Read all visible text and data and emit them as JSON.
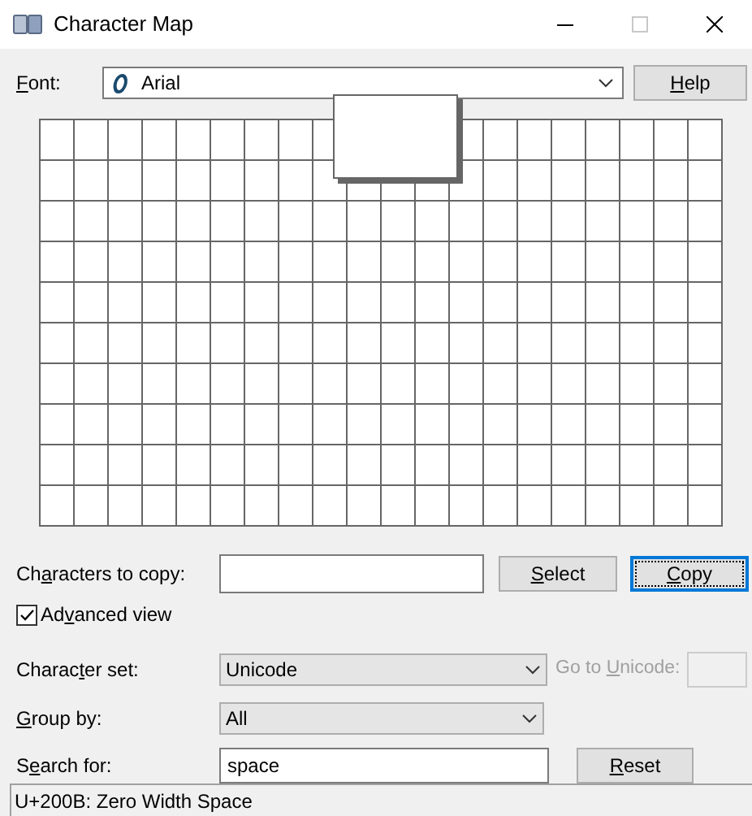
{
  "window": {
    "title": "Character Map",
    "maximize_disabled": true
  },
  "font": {
    "label": [
      {
        "text": "F",
        "underline": true
      },
      {
        "text": "ont:",
        "underline": false
      }
    ],
    "value": "Arial"
  },
  "help_button": {
    "label": [
      {
        "text": "H",
        "underline": true
      },
      {
        "text": "elp",
        "underline": false
      }
    ]
  },
  "copy_row": {
    "label": [
      {
        "text": "Ch",
        "underline": false
      },
      {
        "text": "a",
        "underline": true
      },
      {
        "text": "racters to copy:",
        "underline": false
      }
    ]
  },
  "buttons": [
    {
      "label": [
        {
          "text": "S",
          "underline": true
        },
        {
          "text": "elect",
          "underline": false
        }
      ],
      "focused": false
    },
    {
      "label": [
        {
          "text": "C",
          "underline": true
        },
        {
          "text": "opy",
          "underline": false
        }
      ],
      "focused": true
    }
  ],
  "advanced_view": {
    "label": [
      {
        "text": "Ad",
        "underline": false
      },
      {
        "text": "v",
        "underline": true
      },
      {
        "text": "anced view",
        "underline": false
      }
    ],
    "checked": true
  },
  "character_set": {
    "label": [
      {
        "text": "Charac",
        "underline": false
      },
      {
        "text": "t",
        "underline": true
      },
      {
        "text": "er set:",
        "underline": false
      }
    ],
    "value": "Unicode"
  },
  "go_to_unicode": {
    "label": [
      {
        "text": "Go to ",
        "underline": false
      },
      {
        "text": "U",
        "underline": true
      },
      {
        "text": "nicode:",
        "underline": false
      }
    ],
    "disabled": true
  },
  "group_by": {
    "label": [
      {
        "text": "G",
        "underline": true
      },
      {
        "text": "roup by:",
        "underline": false
      }
    ],
    "value": "All"
  },
  "search": {
    "label": [
      {
        "text": "S",
        "underline": false
      },
      {
        "text": "e",
        "underline": true
      },
      {
        "text": "arch for:",
        "underline": false
      }
    ],
    "value": "space"
  },
  "reset_button": {
    "label": [
      {
        "text": "R",
        "underline": true
      },
      {
        "text": "eset",
        "underline": false
      }
    ]
  },
  "status_bar": "U+200B: Zero Width Space"
}
